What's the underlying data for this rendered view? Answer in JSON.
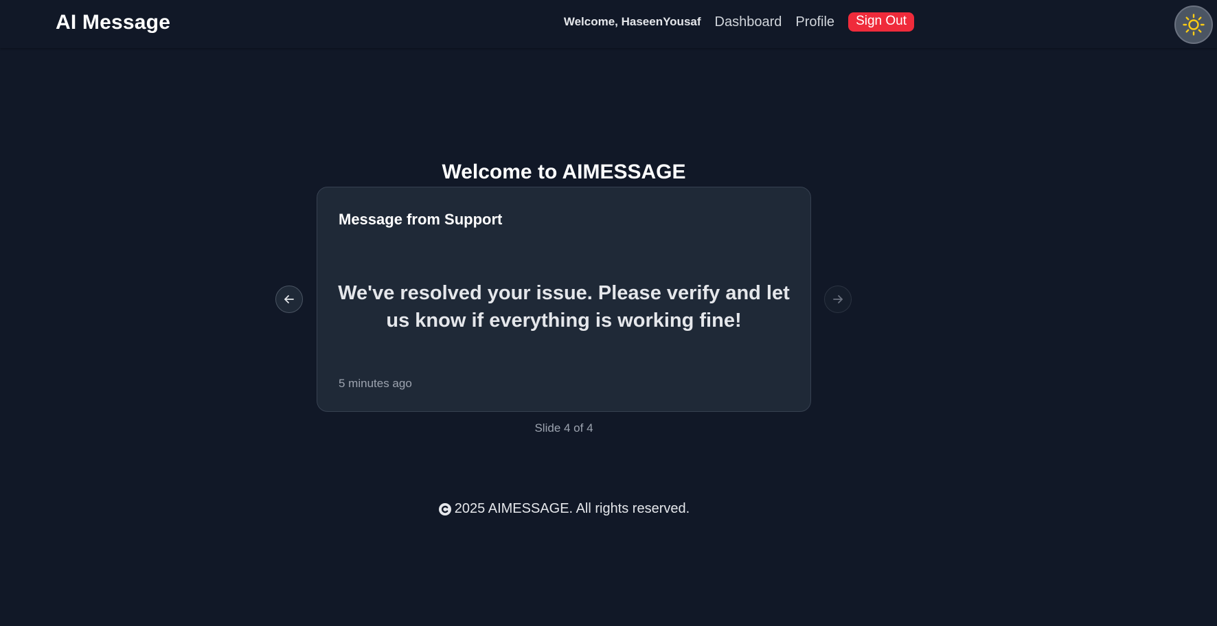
{
  "header": {
    "brand": "AI Message",
    "welcome": "Welcome, HaseenYousaf",
    "nav": {
      "dashboard": "Dashboard",
      "profile": "Profile",
      "sign_out": "Sign Out"
    },
    "theme_toggle_icon": "sun-icon"
  },
  "main": {
    "title": "Welcome to AIMESSAGE",
    "card": {
      "title": "Message from Support",
      "message": "We've resolved your issue. Please verify and let us know if everything is working fine!",
      "time": "5 minutes ago"
    },
    "slide_indicator": "Slide 4 of 4",
    "prev_icon": "arrow-left-icon",
    "next_icon": "arrow-right-icon"
  },
  "footer": {
    "text": "2025 AIMESSAGE. All rights reserved.",
    "icon": "copyright-icon"
  },
  "colors": {
    "background": "#111827",
    "card": "#1f2937",
    "sign_out": "#ef2b3b",
    "sun": "#facc15"
  }
}
